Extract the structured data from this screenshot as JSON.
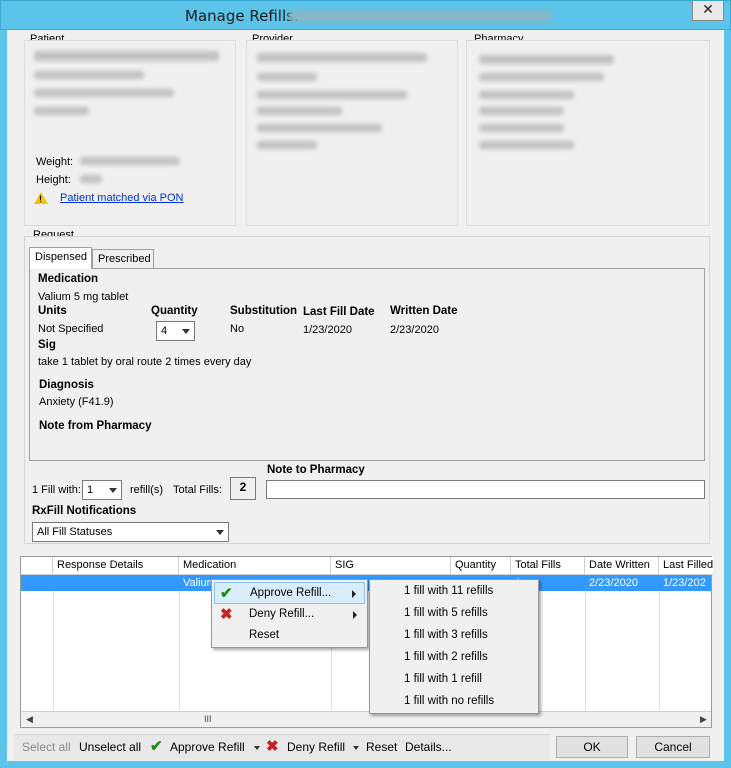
{
  "window": {
    "title": "Manage Refills:",
    "close_label": "✕"
  },
  "patient": {
    "section_label": "Patient",
    "weight_label": "Weight:",
    "height_label": "Height:",
    "matched_link": "Patient matched via PON"
  },
  "provider": {
    "section_label": "Provider"
  },
  "pharmacy": {
    "section_label": "Pharmacy"
  },
  "request": {
    "section_label": "Request",
    "tabs": [
      {
        "label": "Dispensed",
        "active": true
      },
      {
        "label": "Prescribed",
        "active": false
      }
    ],
    "medication_heading": "Medication",
    "medication_value": "Valium 5 mg tablet",
    "units_heading": "Units",
    "units_value": "Not Specified",
    "quantity_heading": "Quantity",
    "quantity_value": "4",
    "substitution_heading": "Substitution",
    "substitution_value": "No",
    "last_fill_heading": "Last Fill Date",
    "last_fill_value": "1/23/2020",
    "written_heading": "Written Date",
    "written_value": "2/23/2020",
    "sig_heading": "Sig",
    "sig_value": "take 1 tablet by oral route 2 times every day",
    "diagnosis_heading": "Diagnosis",
    "diagnosis_value": "Anxiety (F41.9)",
    "note_from_pharmacy_heading": "Note from Pharmacy"
  },
  "fill": {
    "fill_with_label": "1 Fill with:",
    "fill_with_value": "1",
    "refills_label": "refill(s)",
    "total_fills_label": "Total Fills:",
    "total_fills_value": "2",
    "note_to_pharmacy_label": "Note to Pharmacy",
    "note_to_pharmacy_value": ""
  },
  "rxfill": {
    "label": "RxFill Notifications",
    "selected": "All Fill Statuses"
  },
  "grid": {
    "columns": [
      "Response Details",
      "Medication",
      "SIG",
      "Quantity",
      "Total Fills",
      "Date Written",
      "Last Filled"
    ],
    "row": {
      "medication": "Valium",
      "total_fills": "2",
      "date_written": "2/23/2020",
      "last_filled": "1/23/202"
    },
    "scroll_thumb": "III"
  },
  "context_menu": {
    "items": [
      {
        "label": "Approve Refill...",
        "icon": "check-icon",
        "submenu": true
      },
      {
        "label": "Deny Refill...",
        "icon": "x-icon",
        "submenu": true
      },
      {
        "label": "Reset",
        "icon": "",
        "submenu": false
      }
    ]
  },
  "approve_submenu": {
    "items": [
      "1 fill with 11 refills",
      "1 fill with 5 refills",
      "1 fill with 3 refills",
      "1 fill with 2 refills",
      "1 fill with 1 refill",
      "1 fill with no refills"
    ]
  },
  "toolbar": {
    "select_all": "Select all",
    "unselect_all": "Unselect all",
    "approve_refill": "Approve Refill",
    "deny_refill": "Deny Refill",
    "reset": "Reset",
    "details": "Details...",
    "ok": "OK",
    "cancel": "Cancel"
  },
  "colors": {
    "titlebar": "#5bc4e8",
    "selection": "#3399ff",
    "approve_green": "#1a8f1a",
    "deny_red": "#cc1f1f",
    "link_blue": "#0033cc"
  }
}
